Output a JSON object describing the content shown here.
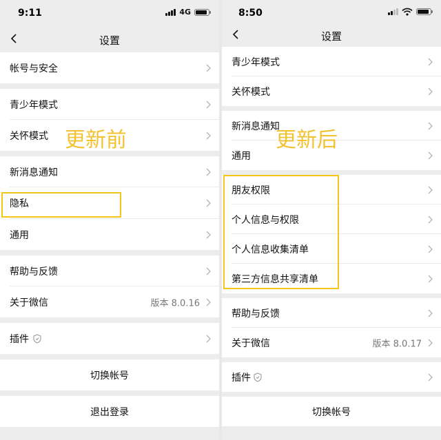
{
  "colors": {
    "highlight": "#f5c518",
    "annotation": "#f2c232",
    "page_bg": "#ededed",
    "row_bg": "#ffffff",
    "chevron": "#b2b2b2",
    "muted_text": "#777777"
  },
  "left": {
    "status": {
      "time": "9:11",
      "network": "4G"
    },
    "nav": {
      "back_icon": "chevron-left-icon",
      "title": "设置"
    },
    "annotation": "更新前",
    "rows": {
      "account_security": {
        "label": "帐号与安全"
      },
      "youth_mode": {
        "label": "青少年模式"
      },
      "care_mode": {
        "label": "关怀模式"
      },
      "new_message_notify": {
        "label": "新消息通知"
      },
      "privacy": {
        "label": "隐私"
      },
      "general": {
        "label": "通用"
      },
      "help_feedback": {
        "label": "帮助与反馈"
      },
      "about_wechat": {
        "label": "关于微信",
        "value": "版本 8.0.16"
      },
      "plugins": {
        "label": "插件",
        "icon": "shield-icon"
      },
      "switch_account": {
        "label": "切换帐号"
      },
      "logout": {
        "label": "退出登录"
      }
    }
  },
  "right": {
    "status": {
      "time": "8:50"
    },
    "nav": {
      "back_icon": "chevron-left-icon",
      "title": "设置"
    },
    "annotation": "更新后",
    "rows": {
      "youth_mode": {
        "label": "青少年模式"
      },
      "care_mode": {
        "label": "关怀模式"
      },
      "new_message_notify": {
        "label": "新消息通知"
      },
      "general": {
        "label": "通用"
      },
      "friend_permissions": {
        "label": "朋友权限"
      },
      "personal_info_permissions": {
        "label": "个人信息与权限"
      },
      "personal_info_collection": {
        "label": "个人信息收集清单"
      },
      "third_party_sharing": {
        "label": "第三方信息共享清单"
      },
      "help_feedback": {
        "label": "帮助与反馈"
      },
      "about_wechat": {
        "label": "关于微信",
        "value": "版本 8.0.17"
      },
      "plugins": {
        "label": "插件",
        "icon": "shield-icon"
      },
      "switch_account": {
        "label": "切换帐号"
      }
    }
  }
}
